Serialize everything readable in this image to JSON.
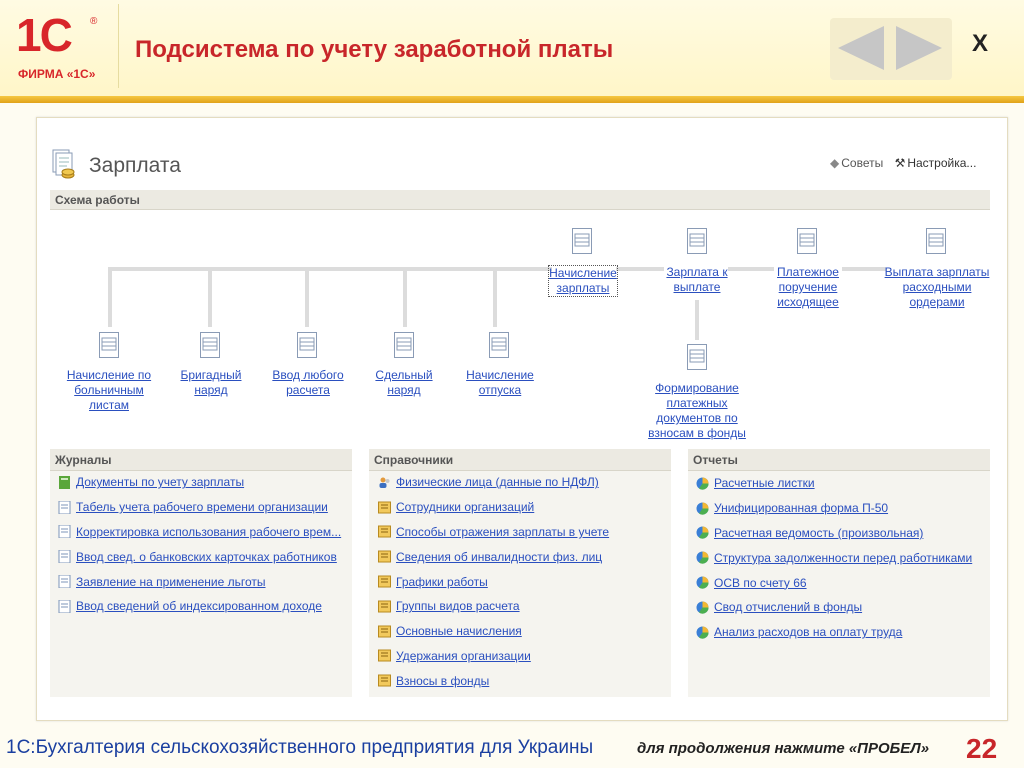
{
  "header": {
    "logo_mark": "1С",
    "logo_firm": "ФИРМА «1С»",
    "title": "Подсистема по учету заработной платы",
    "close_label": "Х"
  },
  "window": {
    "title": "Зарплата",
    "hint_advice": "Советы",
    "hint_settings": "Настройка..."
  },
  "schema": {
    "header": "Схема работы",
    "top_nodes": [
      "Начисление зарплаты",
      "Зарплата к выплате",
      "Платежное поручение исходящее",
      "Выплата зарплаты расходными ордерами"
    ],
    "bottom_nodes": [
      "Начисление по больничным листам",
      "Бригадный наряд",
      "Ввод любого расчета",
      "Сдельный наряд",
      "Начисление отпуска"
    ],
    "extra_node": "Формирование платежных документов по взносам в фонды"
  },
  "journals": {
    "header": "Журналы",
    "items": [
      "Документы по учету зарплаты",
      "Табель учета рабочего времени организации",
      "Корректировка использования рабочего врем...",
      "Ввод свед. о банковских карточках работников",
      "Заявление на применение льготы",
      "Ввод сведений об индексированном доходе"
    ]
  },
  "catalogs": {
    "header": "Справочники",
    "items": [
      "Физические лица (данные по НДФЛ)",
      "Сотрудники организаций",
      "Способы отражения зарплаты в учете",
      "Сведения об инвалидности физ. лиц",
      "Графики работы",
      "Группы видов расчета",
      "Основные начисления",
      "Удержания организации",
      "Взносы в фонды"
    ]
  },
  "reports": {
    "header": "Отчеты",
    "items": [
      "Расчетные листки",
      "Унифицированная форма П-50",
      "Расчетная ведомость (произвольная)",
      "Структура задолженности перед работниками",
      "ОСВ по счету 66",
      "Свод отчислений в фонды",
      "Анализ расходов на оплату труда"
    ]
  },
  "footer": {
    "product": "1С:Бухгалтерия сельскохозяйственного предприятия для Украины",
    "continue_hint": "для продолжения нажмите «ПРОБЕЛ»",
    "page_number": "22"
  },
  "colors": {
    "accent_red": "#c8262a",
    "link_blue": "#2a4fbf",
    "gold_bar": "#e0a21a"
  }
}
